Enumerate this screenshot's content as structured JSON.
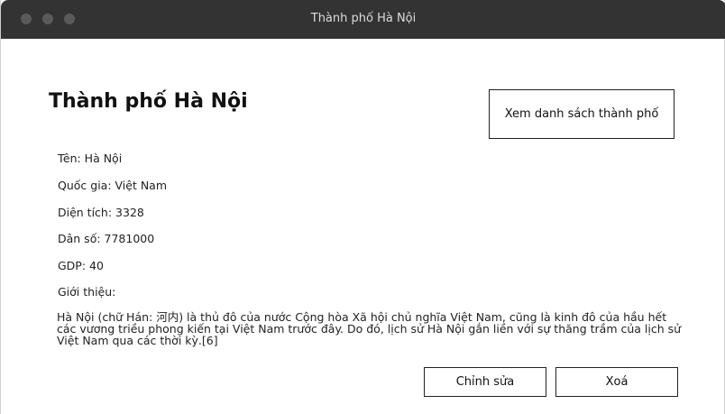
{
  "window": {
    "title": "Thành phố Hà Nội"
  },
  "page": {
    "heading": "Thành phố Hà Nội",
    "list_button_label": "Xem danh sách thành phố"
  },
  "fields": {
    "name": "Tên: Hà Nội",
    "country": "Quốc gia: Việt Nam",
    "area": "Diện tích: 3328",
    "population": "Dân số: 7781000",
    "gdp": "GDP: 40",
    "intro_label": "Giới thiệu:"
  },
  "intro_text": "Hà Nội (chữ Hán: 河内) là thủ đô của nước Cộng hòa Xã hội chủ nghĩa Việt Nam, cũng là kinh đô của hầu hết các vương triều phong kiến tại Việt Nam trước đây. Do đó, lịch sử Hà Nội gắn liền với sự thăng trầm của lịch sử Việt Nam qua các thời kỳ.[6]",
  "actions": {
    "edit_label": "Chỉnh sửa",
    "delete_label": "Xoá"
  }
}
